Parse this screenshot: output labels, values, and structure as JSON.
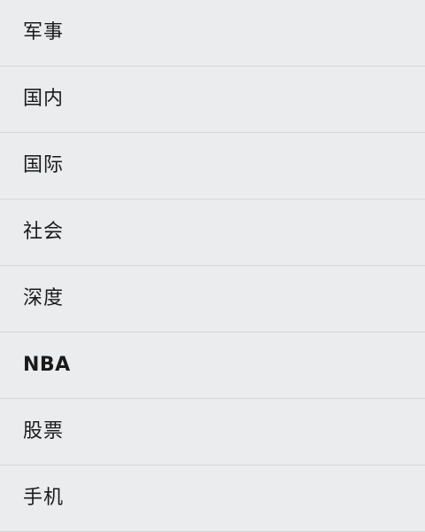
{
  "channel_list": {
    "items": [
      {
        "label": "军事"
      },
      {
        "label": "国内"
      },
      {
        "label": "国际"
      },
      {
        "label": "社会"
      },
      {
        "label": "深度"
      },
      {
        "label": "NBA"
      },
      {
        "label": "股票"
      },
      {
        "label": "手机"
      }
    ]
  }
}
